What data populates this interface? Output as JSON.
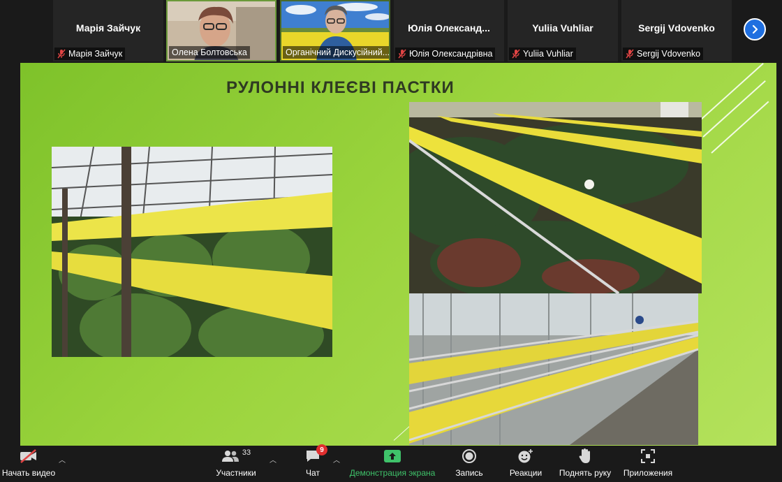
{
  "participants": [
    {
      "name": "Марія Зайчук",
      "label": "Марія Зайчук",
      "video": false,
      "muted": true
    },
    {
      "name": "",
      "label": "Олена Болтовська",
      "video": true,
      "muted": false
    },
    {
      "name": "",
      "label": "Органічний Дискусійний...",
      "video": true,
      "muted": false
    },
    {
      "name": "Юлія  Олександ...",
      "label": "Юлія Олександрівна",
      "video": false,
      "muted": true
    },
    {
      "name": "Yuliia Vuhliar",
      "label": "Yuliia Vuhliar",
      "video": false,
      "muted": true
    },
    {
      "name": "Sergij Vdovenko",
      "label": "Sergij Vdovenko",
      "video": false,
      "muted": true
    }
  ],
  "slide": {
    "title": "РУЛОННІ КЛЕЄВІ ПАСТКИ"
  },
  "toolbar": {
    "video_label": "Начать видео",
    "participants_label": "Участники",
    "participants_count": "33",
    "chat_label": "Чат",
    "chat_badge": "9",
    "share_label": "Демонстрация экрана",
    "record_label": "Запись",
    "reactions_label": "Реакции",
    "raise_hand_label": "Поднять руку",
    "apps_label": "Приложения"
  },
  "colors": {
    "accent_blue": "#1f6fe0",
    "share_green": "#3fc26a",
    "slide_green": "#8ccb33",
    "trap_yellow": "#e9e04a",
    "badge_red": "#e02e2e"
  }
}
